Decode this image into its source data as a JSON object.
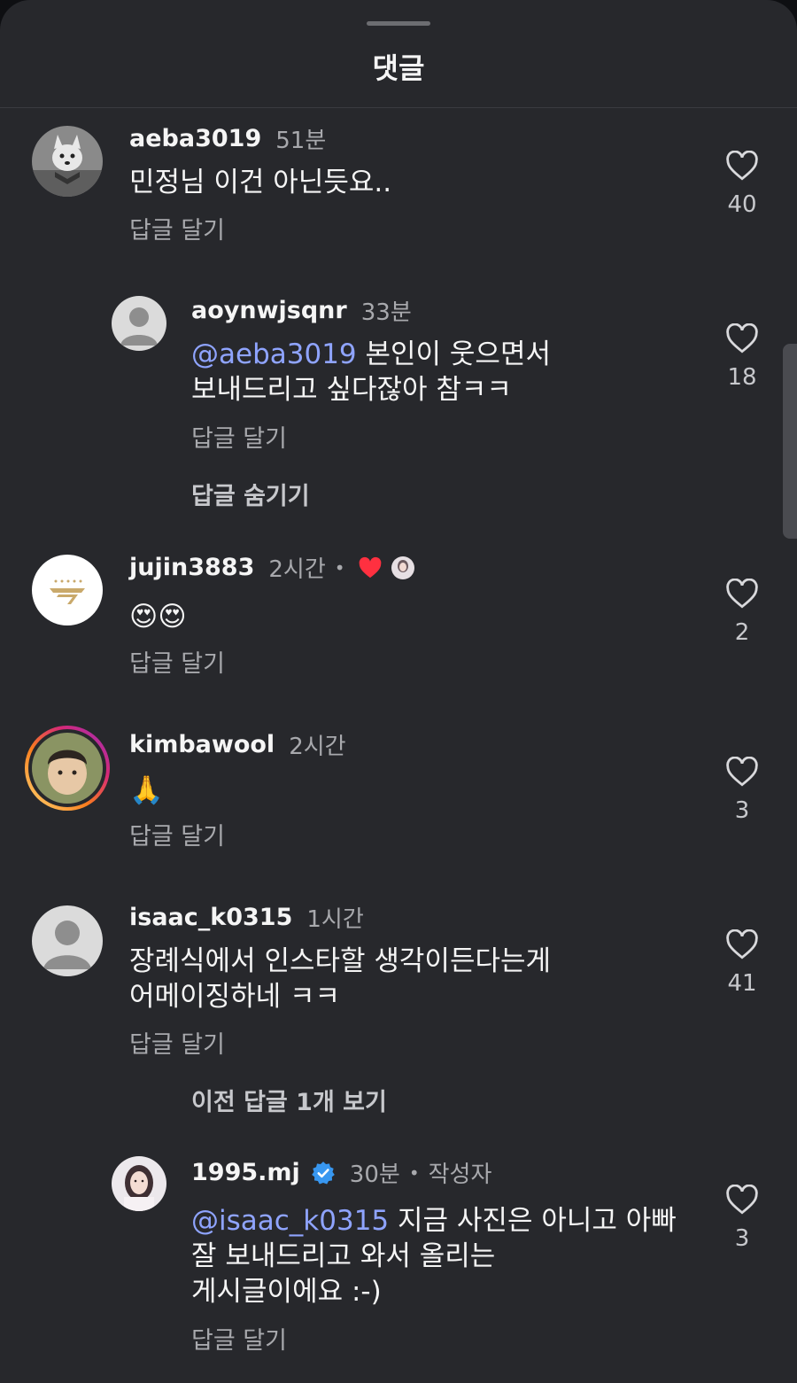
{
  "sheet": {
    "title": "댓글"
  },
  "comments": [
    {
      "username": "aeba3019",
      "time": "51분",
      "text": "민정님 이건 아닌듯요..",
      "reply_label": "답글 달기",
      "likes": "40"
    },
    {
      "username": "aoynwjsqnr",
      "time": "33분",
      "mention": "@aeba3019",
      "text_line1": " 본인이 웃으면서",
      "text_line2": "보내드리고 싶다잖아 참ㅋㅋ",
      "reply_label": "답글 달기",
      "likes": "18",
      "thread_toggle": "답글 숨기기"
    },
    {
      "username": "jujin3883",
      "time": "2시간",
      "separator": "•",
      "text": "😍😍",
      "reply_label": "답글 달기",
      "likes": "2"
    },
    {
      "username": "kimbawool",
      "time": "2시간",
      "text": "🙏",
      "reply_label": "답글 달기",
      "likes": "3"
    },
    {
      "username": "isaac_k0315",
      "time": "1시간",
      "text_line1": "장례식에서 인스타할 생각이든다는게",
      "text_line2": "어메이징하네 ㅋㅋ",
      "reply_label": "답글 달기",
      "likes": "41",
      "thread_toggle": "이전 답글 1개 보기"
    },
    {
      "username": "1995.mj",
      "time": "30분",
      "separator": "•",
      "author_tag": "작성자",
      "mention": "@isaac_k0315",
      "text_line1": " 지금 사진은 아니고 아빠",
      "text_line2": "잘 보내드리고 와서 올리는",
      "text_line3": "게시글이에요 :-)",
      "reply_label": "답글 달기",
      "likes": "3"
    }
  ],
  "icons": {
    "like": "heart-outline-icon",
    "verified": "verified-badge-icon",
    "liked_by_creator": "heart-filled-icon"
  },
  "colors": {
    "background": "#27282c",
    "mention": "#8fa4ff",
    "verified": "#3897f0",
    "heart": "#ff3040"
  }
}
